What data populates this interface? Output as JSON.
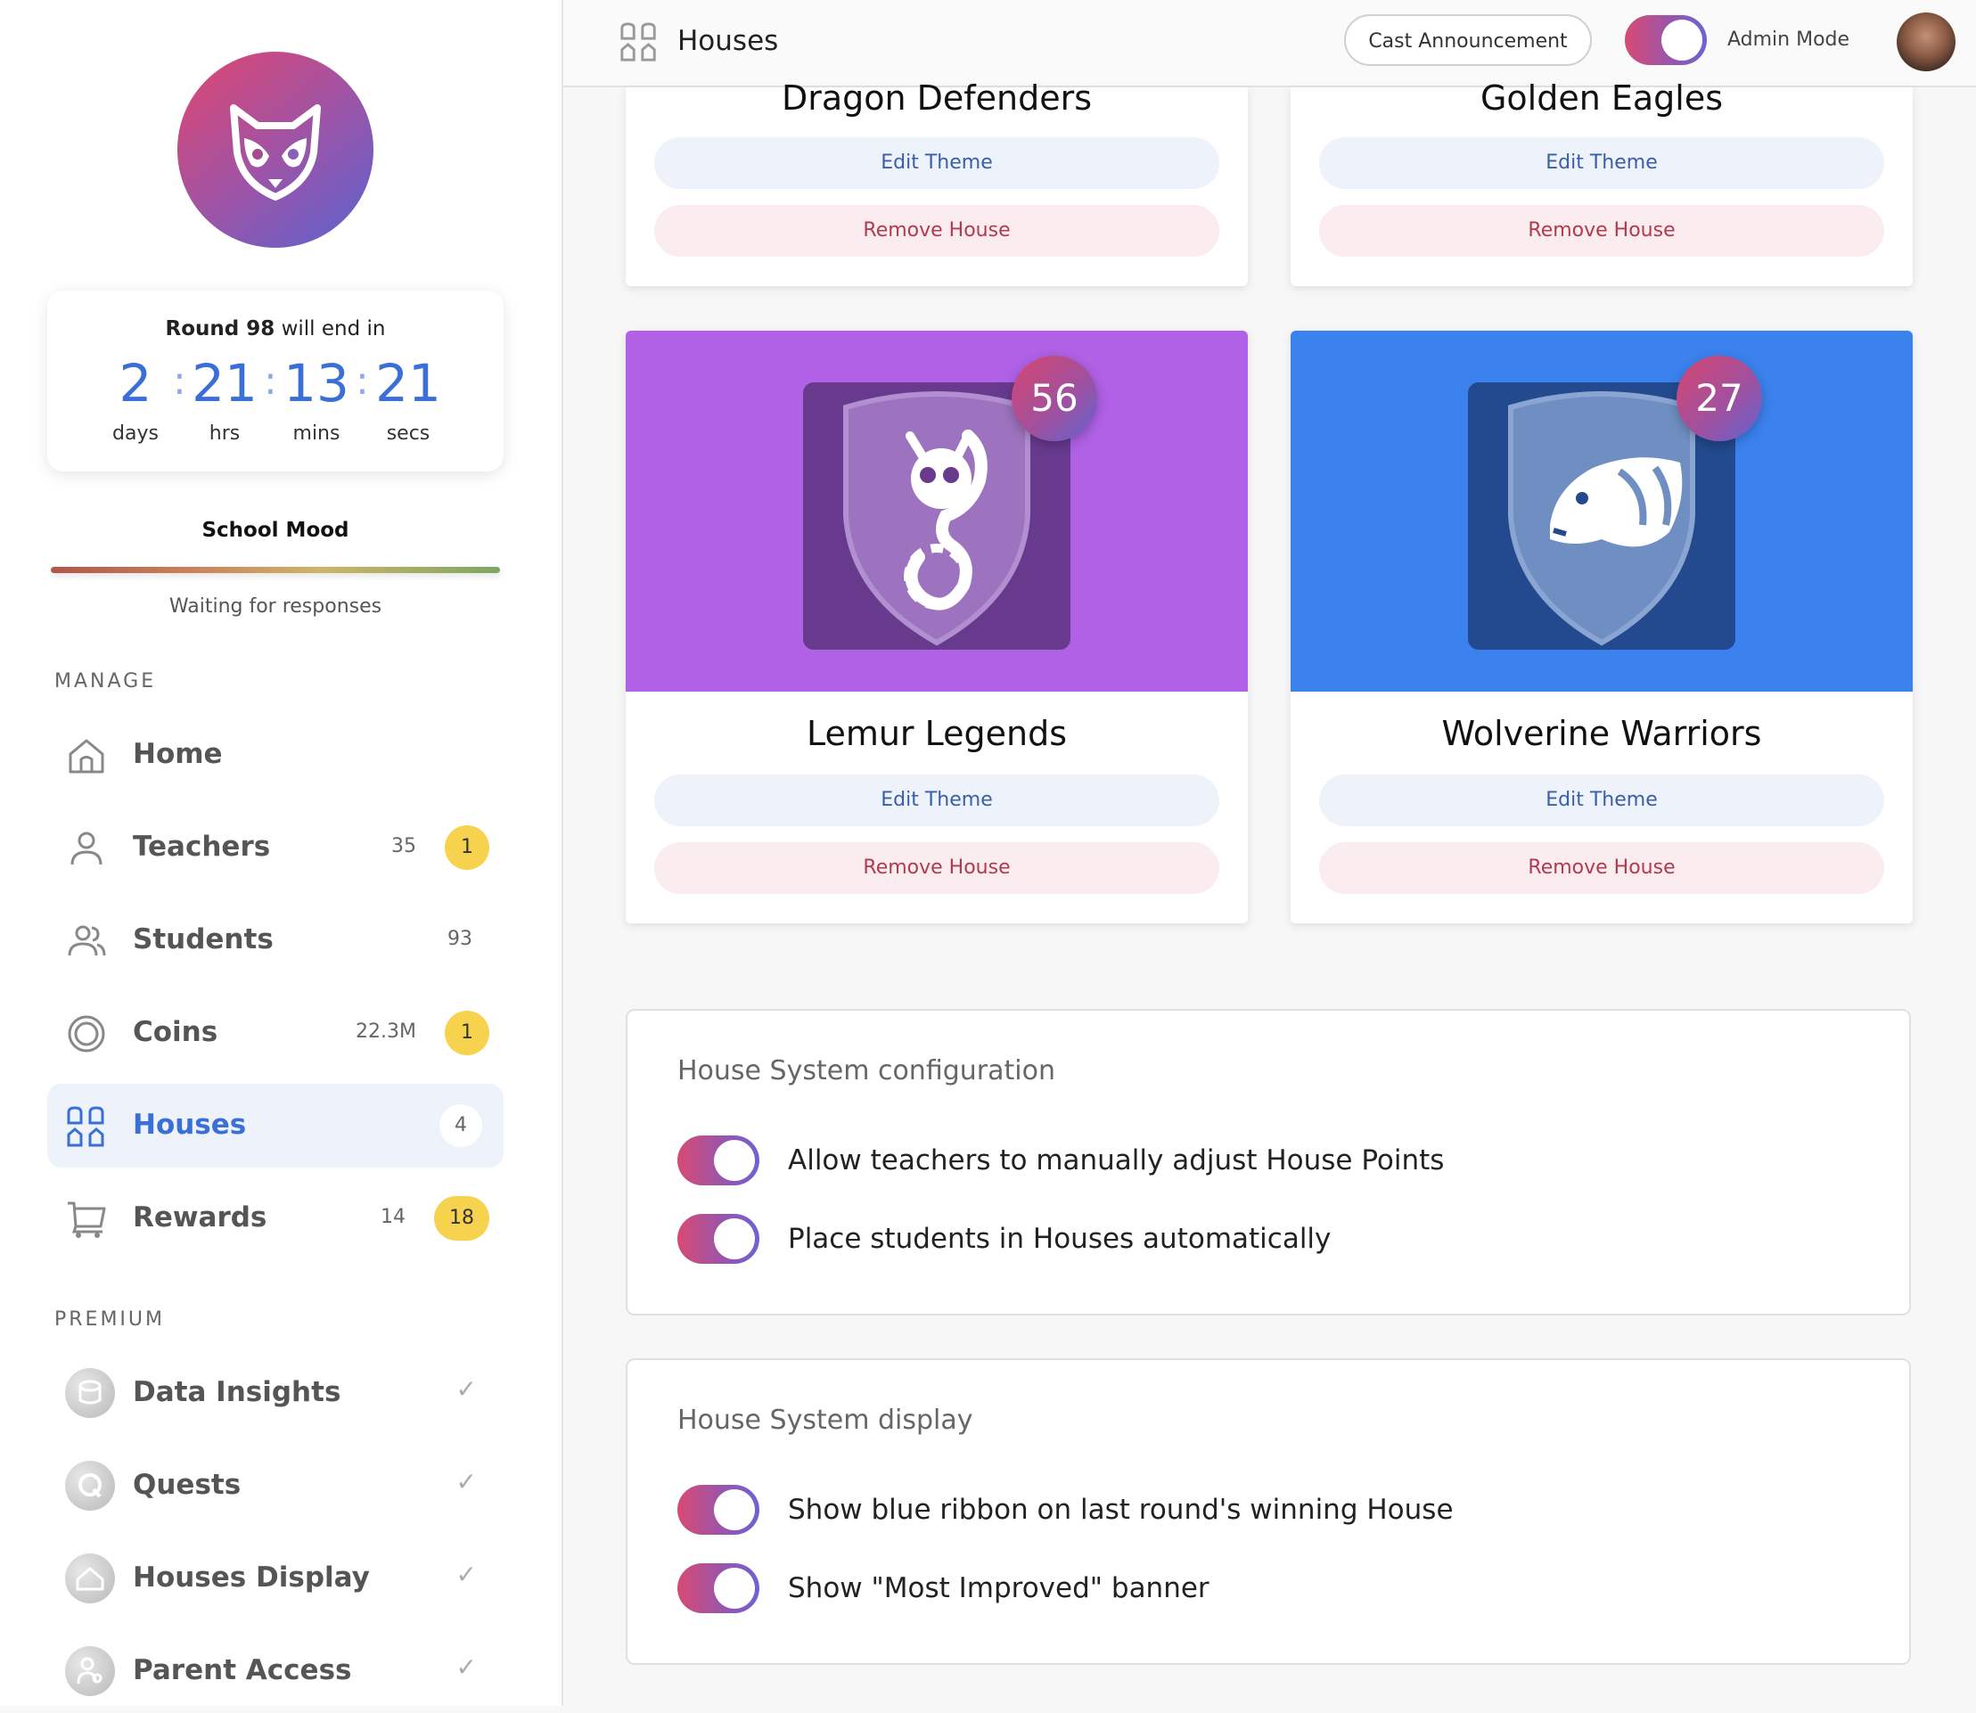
{
  "header": {
    "title": "Houses",
    "cast_button": "Cast Announcement",
    "admin_mode_label": "Admin Mode",
    "admin_mode_on": true
  },
  "timer": {
    "round_label": "Round 98",
    "suffix": "will end in",
    "days": "2",
    "hrs": "21",
    "mins": "13",
    "secs": "21",
    "days_label": "days",
    "hrs_label": "hrs",
    "mins_label": "mins",
    "secs_label": "secs"
  },
  "mood": {
    "title": "School Mood",
    "status": "Waiting for responses"
  },
  "sidebar": {
    "manage_label": "MANAGE",
    "premium_label": "PREMIUM",
    "manage_items": [
      {
        "label": "Home",
        "icon": "home-icon"
      },
      {
        "label": "Teachers",
        "count": "35",
        "badge": "1",
        "icon": "user-icon"
      },
      {
        "label": "Students",
        "count": "93",
        "icon": "users-icon"
      },
      {
        "label": "Coins",
        "count": "22.3M",
        "badge": "1",
        "icon": "coin-icon"
      },
      {
        "label": "Houses",
        "badge": "4",
        "icon": "houses-icon",
        "active": true
      },
      {
        "label": "Rewards",
        "count": "14",
        "badge": "18",
        "icon": "cart-icon"
      }
    ],
    "premium_items": [
      {
        "label": "Data Insights",
        "icon": "database-icon"
      },
      {
        "label": "Quests",
        "icon": "quest-icon"
      },
      {
        "label": "Houses Display",
        "icon": "house-display-icon"
      },
      {
        "label": "Parent Access",
        "icon": "parent-icon"
      }
    ]
  },
  "houses": [
    {
      "name": "Dragon Defenders",
      "edit_label": "Edit Theme",
      "remove_label": "Remove House"
    },
    {
      "name": "Golden Eagles",
      "edit_label": "Edit Theme",
      "remove_label": "Remove House"
    },
    {
      "name": "Lemur Legends",
      "score": "56",
      "edit_label": "Edit Theme",
      "remove_label": "Remove House",
      "bg_color": "#b061e6",
      "crest_color": "#673a8e"
    },
    {
      "name": "Wolverine Warriors",
      "score": "27",
      "edit_label": "Edit Theme",
      "remove_label": "Remove House",
      "bg_color": "#3b82ee",
      "crest_color": "#234a8e"
    }
  ],
  "config": {
    "title": "House System configuration",
    "options": [
      {
        "label": "Allow teachers to manually adjust House Points",
        "on": true
      },
      {
        "label": "Place students in Houses automatically",
        "on": true
      }
    ]
  },
  "display": {
    "title": "House System display",
    "options": [
      {
        "label": "Show blue ribbon on last round's winning House",
        "on": true
      },
      {
        "label": "Show \"Most Improved\" banner",
        "on": true
      }
    ]
  },
  "colors": {
    "accent_blue": "#3a6fd8",
    "badge_yellow": "#f6d24f",
    "toggle_gradient_start": "#d84a73",
    "toggle_gradient_end": "#6c63d6"
  }
}
